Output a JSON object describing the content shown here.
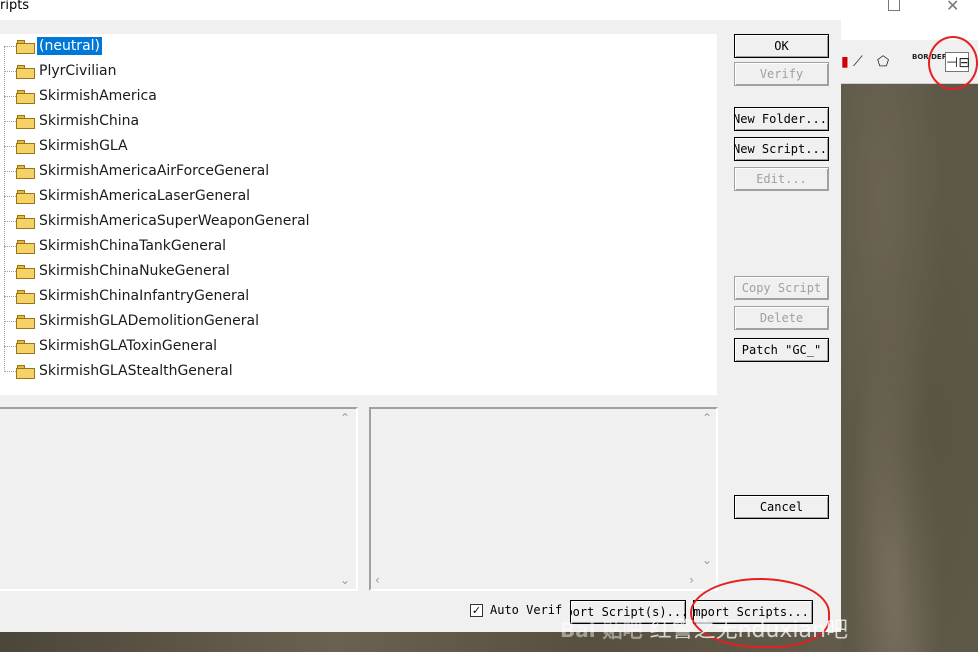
{
  "dialog": {
    "title": "ripts"
  },
  "tree": {
    "items": [
      {
        "label": "(neutral)",
        "selected": true
      },
      {
        "label": "PlyrCivilian"
      },
      {
        "label": "SkirmishAmerica"
      },
      {
        "label": "SkirmishChina"
      },
      {
        "label": "SkirmishGLA"
      },
      {
        "label": "SkirmishAmericaAirForceGeneral"
      },
      {
        "label": "SkirmishAmericaLaserGeneral"
      },
      {
        "label": "SkirmishAmericaSuperWeaponGeneral"
      },
      {
        "label": "SkirmishChinaTankGeneral"
      },
      {
        "label": "SkirmishChinaNukeGeneral"
      },
      {
        "label": "SkirmishChinaInfantryGeneral"
      },
      {
        "label": "SkirmishGLADemolitionGeneral"
      },
      {
        "label": "SkirmishGLAToxinGeneral"
      },
      {
        "label": "SkirmishGLAStealthGeneral"
      }
    ]
  },
  "buttons": {
    "ok": "OK",
    "verify": "Verify",
    "new_folder": "New Folder...",
    "new_script": "New Script...",
    "edit": "Edit...",
    "copy_script": "Copy Script",
    "delete": "Delete",
    "patch": "Patch \"GC_\"",
    "cancel": "Cancel",
    "export": "Export Script(s)...",
    "import": "Import Scripts..."
  },
  "auto_verify": {
    "label": "Auto Verif",
    "checked": true
  },
  "toolbar": {
    "border_label": "BOR DER"
  },
  "watermark": {
    "brand": "Bai 贴吧",
    "text": "红警之无nduxian吧"
  },
  "colors": {
    "selection": "#0078d7",
    "annotation": "#e52020"
  }
}
